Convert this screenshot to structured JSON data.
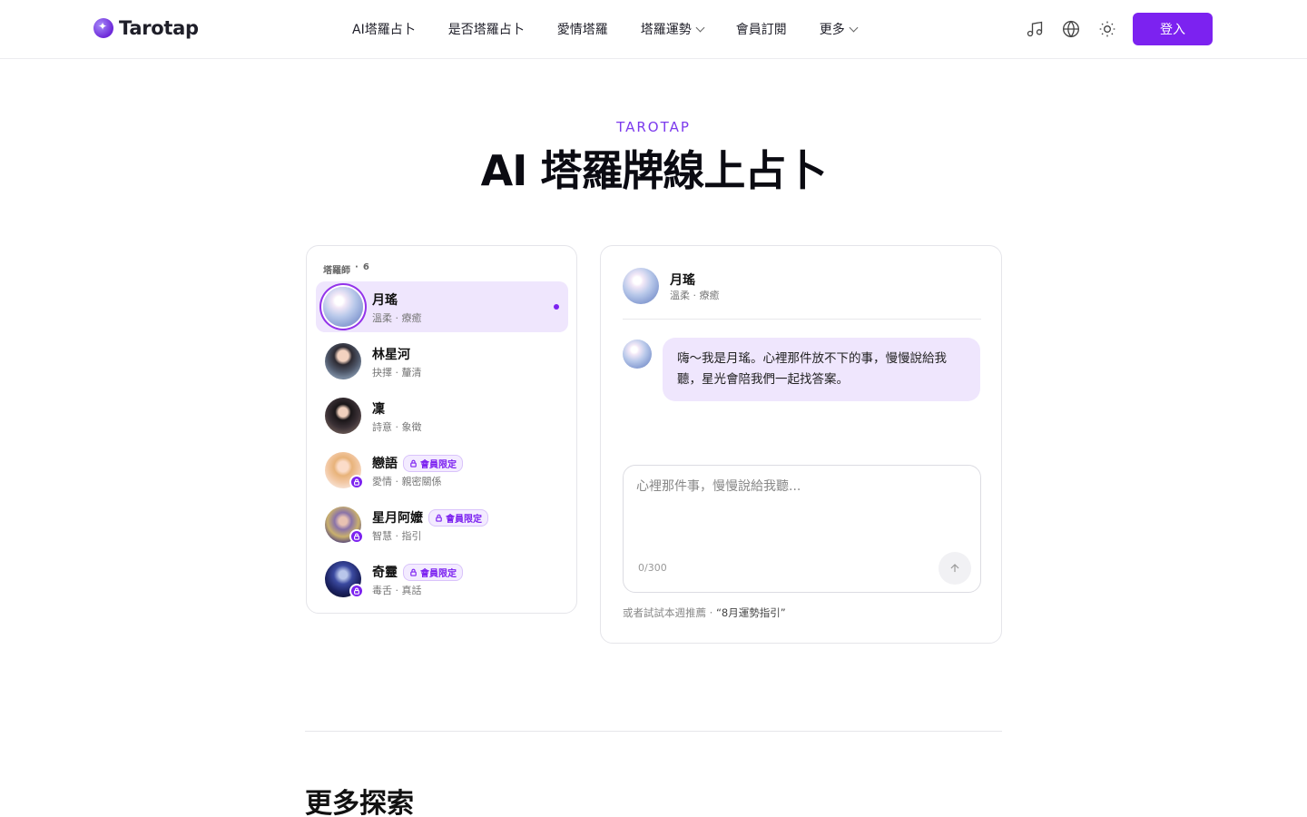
{
  "header": {
    "logo_text": "Tarotap",
    "nav": [
      {
        "label": "AI塔羅占卜",
        "has_dropdown": false
      },
      {
        "label": "是否塔羅占卜",
        "has_dropdown": false
      },
      {
        "label": "愛情塔羅",
        "has_dropdown": false
      },
      {
        "label": "塔羅運勢",
        "has_dropdown": true
      },
      {
        "label": "會員訂閱",
        "has_dropdown": false
      },
      {
        "label": "更多",
        "has_dropdown": true
      }
    ],
    "icons": [
      "music-note-icon",
      "globe-icon",
      "sun-icon"
    ],
    "login_label": "登入",
    "accent_color": "#7c22f0"
  },
  "hero": {
    "eyebrow": "TAROTAP",
    "title": "AI 塔羅牌線上占卜"
  },
  "readers_panel": {
    "label": "塔羅師",
    "separator": "·",
    "count": "6",
    "readers": [
      {
        "name": "月瑤",
        "tags": "溫柔 · 療癒",
        "selected": true,
        "members_only": false,
        "avatar": "av-yue"
      },
      {
        "name": "林星河",
        "tags": "抉擇 · 釐清",
        "selected": false,
        "members_only": false,
        "avatar": "av-lin"
      },
      {
        "name": "凜",
        "tags": "詩意 · 象徵",
        "selected": false,
        "members_only": false,
        "avatar": "av-lin2"
      },
      {
        "name": "戀語",
        "tags": "愛情 · 親密關係",
        "selected": false,
        "members_only": true,
        "avatar": "av-lian"
      },
      {
        "name": "星月阿嬤",
        "tags": "智慧 · 指引",
        "selected": false,
        "members_only": true,
        "avatar": "av-xing"
      },
      {
        "name": "奇靈",
        "tags": "毒舌 · 真話",
        "selected": false,
        "members_only": true,
        "avatar": "av-qi"
      }
    ],
    "members_tag_label": "會員限定"
  },
  "chat": {
    "reader_name": "月瑤",
    "reader_tags": "溫柔 · 療癒",
    "greeting": "嗨～我是月瑤。心裡那件放不下的事，慢慢說給我聽，星光會陪我們一起找答案。",
    "input_placeholder": "心裡那件事，慢慢說給我聽...",
    "counter": "0/300",
    "suggest_prefix": "或者試試本週推薦 · ",
    "suggest_link": "“8月運勢指引”"
  },
  "more_section": {
    "title": "更多探索"
  }
}
